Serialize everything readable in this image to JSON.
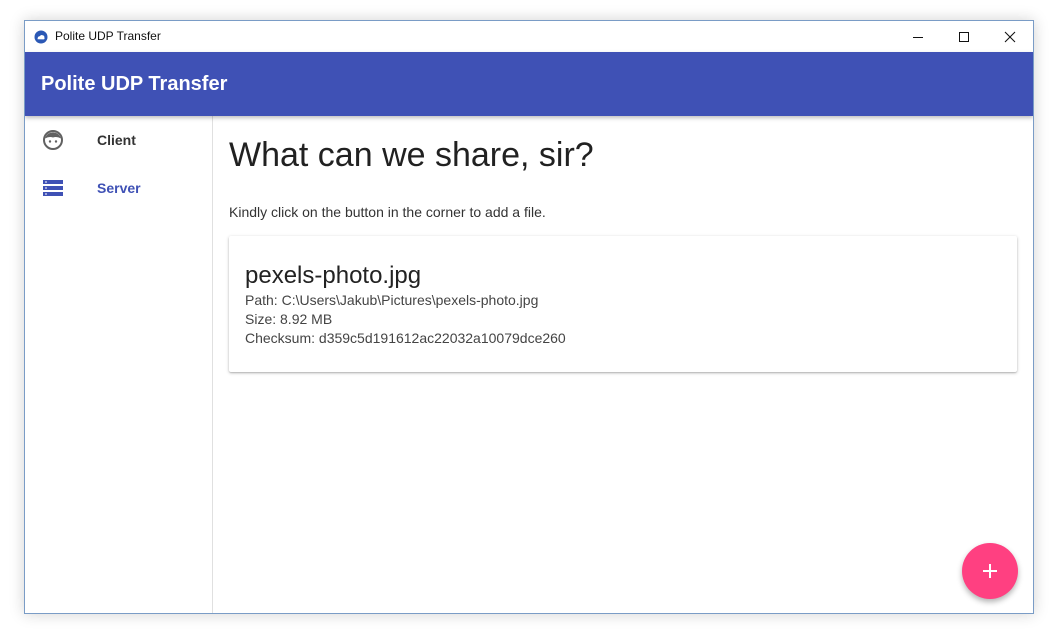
{
  "window": {
    "title": "Polite UDP Transfer",
    "controls": {
      "minimize": "minimize-icon",
      "maximize": "maximize-icon",
      "close": "close-icon"
    }
  },
  "appbar": {
    "title": "Polite UDP Transfer",
    "color": "#3f51b5"
  },
  "sidebar": {
    "items": [
      {
        "label": "Client",
        "icon": "face-icon",
        "active": false
      },
      {
        "label": "Server",
        "icon": "storage-icon",
        "active": true
      }
    ],
    "active_color": "#3f51b5",
    "inactive_color": "#333333"
  },
  "main": {
    "heading": "What can we share, sir?",
    "instructions": "Kindly click on the button in the corner to add a file.",
    "files": [
      {
        "name": "pexels-photo.jpg",
        "path": "Path: C:\\Users\\Jakub\\Pictures\\pexels-photo.jpg",
        "size": "Size: 8.92 MB",
        "checksum": "Checksum: d359c5d191612ac22032a10079dce260"
      }
    ]
  },
  "fab": {
    "icon": "plus-icon",
    "color": "#ff4081"
  }
}
